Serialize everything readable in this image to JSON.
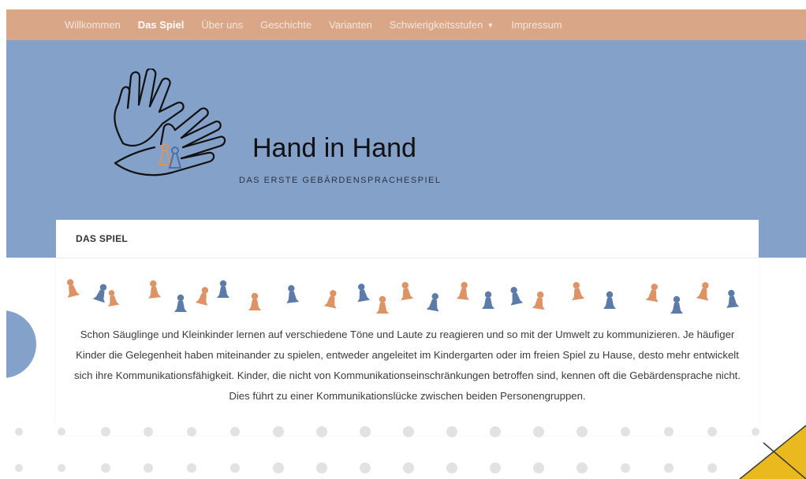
{
  "nav": {
    "items": [
      {
        "label": "Willkommen",
        "active": false
      },
      {
        "label": "Das Spiel",
        "active": true
      },
      {
        "label": "Über uns",
        "active": false
      },
      {
        "label": "Geschichte",
        "active": false
      },
      {
        "label": "Varianten",
        "active": false
      },
      {
        "label": "Schwierigkeitsstufen",
        "active": false,
        "has_dropdown": true
      },
      {
        "label": "Impressum",
        "active": false
      }
    ]
  },
  "hero": {
    "logo_icon": "hands-with-pawns-icon",
    "title": "Hand in Hand",
    "subtitle": "DAS ERSTE GEBÄRDENSPRACHESPIEL"
  },
  "content": {
    "heading": "DAS SPIEL",
    "pawn_icon": "game-pawn-icon",
    "paragraph": "Schon Säuglinge und Kleinkinder lernen auf verschiedene Töne und Laute zu reagieren und so mit der Umwelt zu kommunizieren. Je häufiger Kinder die Gelegenheit haben miteinander zu spielen, entweder angeleitet im Kindergarten oder im freien Spiel zu Hause, desto mehr entwickelt sich ihre Kommunikationsfähigkeit. Kinder, die nicht von Kommunikationseinschränkungen betroffen sind, kennen oft die Gebärdensprache nicht. Dies führt zu einer Kommunikationslücke zwischen beiden Personengruppen."
  },
  "colors": {
    "nav_bg": "#d9a788",
    "hero_bg": "#84a1c9",
    "pawn_orange": "#dd9365",
    "pawn_blue": "#5d7ba8",
    "accent_yellow": "#e9b91e"
  }
}
